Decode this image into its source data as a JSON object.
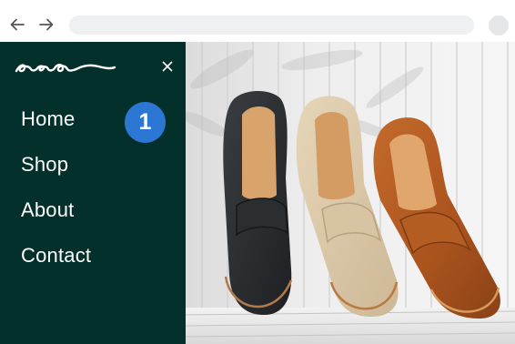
{
  "browser": {
    "back_icon": "arrow-left-icon",
    "forward_icon": "arrow-right-icon",
    "address_value": ""
  },
  "sidebar": {
    "background": "#04302c",
    "logo_icon": "brand-script-logo",
    "close_icon": "close-icon",
    "items": [
      {
        "label": "Home"
      },
      {
        "label": "Shop"
      },
      {
        "label": "About"
      },
      {
        "label": "Contact"
      }
    ]
  },
  "step_badge": {
    "value": "1",
    "color": "#2c77d4"
  },
  "hero": {
    "image": "three penny loafers (black, beige suede, tan leather) on white wooden boards"
  }
}
